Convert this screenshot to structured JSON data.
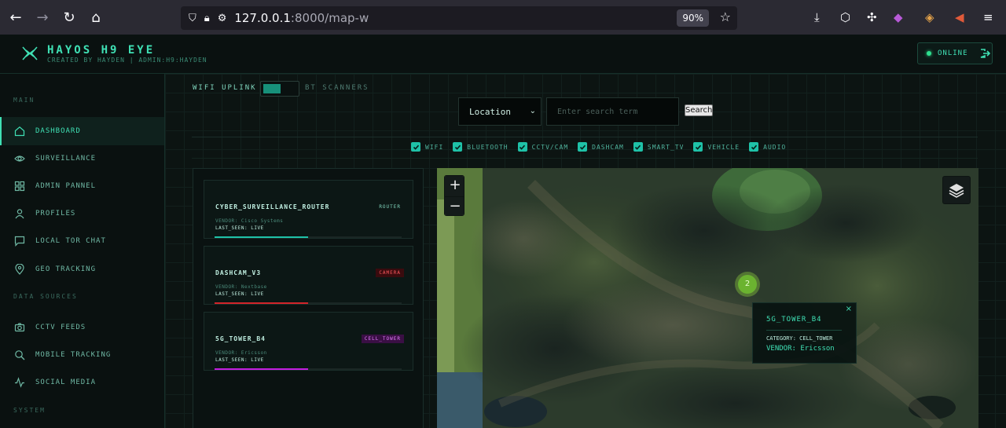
{
  "browser": {
    "url_host": "127.0.0.1",
    "url_path": ":8000/map-w",
    "zoom": "90%"
  },
  "header": {
    "title": "HAYOS H9 EYE",
    "subtitle": "CREATED BY HAYDEN | ADMIN:H9:HAYDEN",
    "status": "ONLINE"
  },
  "sidebar": {
    "sections": [
      {
        "label": "MAIN"
      },
      {
        "label": "DATA SOURCES"
      },
      {
        "label": "SYSTEM"
      }
    ],
    "items": [
      {
        "label": "DASHBOARD",
        "icon": "home-icon"
      },
      {
        "label": "SURVEILLANCE",
        "icon": "eye-icon"
      },
      {
        "label": "ADMIN PANNEL",
        "icon": "grid-icon"
      },
      {
        "label": "PROFILES",
        "icon": "user-icon"
      },
      {
        "label": "LOCAL TOR CHAT",
        "icon": "chat-icon"
      },
      {
        "label": "GEO TRACKING",
        "icon": "location-pin-icon"
      },
      {
        "label": "CCTV FEEDS",
        "icon": "camera-icon"
      },
      {
        "label": "MOBILE TRACKING",
        "icon": "search-icon"
      },
      {
        "label": "SOCIAL MEDIA",
        "icon": "activity-icon"
      }
    ]
  },
  "toolbar": {
    "wifi_label": "WIFI UPLINK",
    "bt_label": "BT SCANNERS",
    "location_value": "Location",
    "search_placeholder": "Enter search term",
    "search_button": "Search"
  },
  "filters": [
    {
      "label": "WIFI",
      "checked": true
    },
    {
      "label": "BLUETOOTH",
      "checked": true
    },
    {
      "label": "CCTV/CAM",
      "checked": true
    },
    {
      "label": "DASHCAM",
      "checked": true
    },
    {
      "label": "SMART_TV",
      "checked": true
    },
    {
      "label": "VEHICLE",
      "checked": true
    },
    {
      "label": "AUDIO",
      "checked": true
    }
  ],
  "devices": [
    {
      "name": "CYBER_SURVEILLANCE_ROUTER",
      "tag": "ROUTER",
      "vendor": "VENDOR: Cisco Systems",
      "last_seen": "LAST_SEEN: LIVE",
      "color": "#1fc2a8",
      "tag_bg": "#0c1715",
      "tag_color": "#7fd4bc",
      "signal": 0.5
    },
    {
      "name": "DASHCAM_V3",
      "tag": "CAMERA",
      "vendor": "VENDOR: Nextbase",
      "last_seen": "LAST_SEEN: LIVE",
      "color": "#d3242a",
      "tag_bg": "#3a0b0e",
      "tag_color": "#ff5a5f",
      "signal": 0.5
    },
    {
      "name": "5G_TOWER_B4",
      "tag": "CELL_TOWER",
      "vendor": "VENDOR: Ericsson",
      "last_seen": "LAST_SEEN: LIVE",
      "color": "#c31ee0",
      "tag_bg": "#3a0f44",
      "tag_color": "#e57bff",
      "signal": 0.5
    }
  ],
  "map": {
    "cluster_count": "2",
    "popup": {
      "title": "5G_TOWER_B4",
      "category": "CATEGORY: CELL_TOWER",
      "vendor": "VENDOR: Ericsson",
      "close": "×"
    }
  }
}
